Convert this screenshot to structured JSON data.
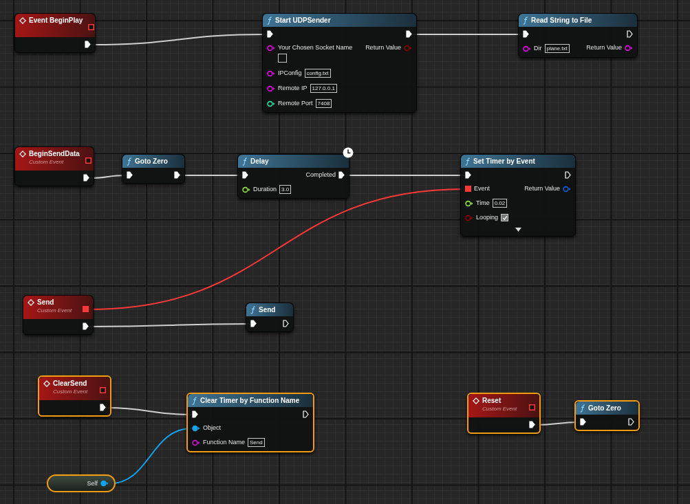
{
  "nodes": [
    {
      "kind": "event",
      "title": "Event BeginPlay",
      "selected": false,
      "delegate": {
        "connected": false
      },
      "rows": [
        {
          "right": {
            "kind": "exec",
            "connected": true
          }
        }
      ]
    },
    {
      "kind": "function",
      "title": "Start UDPSender",
      "selected": false,
      "rows": [
        {
          "left": {
            "kind": "exec",
            "connected": true
          },
          "right": {
            "kind": "exec",
            "connected": true
          }
        },
        {
          "left": {
            "kind": "string",
            "label": "Your Chosen Socket Name",
            "empty_field": true,
            "connected": false
          },
          "right": {
            "kind": "bool",
            "label": "Return Value",
            "connected": false
          }
        },
        {
          "left": {
            "kind": "string",
            "label": "IPConfig",
            "value": "config.txt",
            "connected": false
          }
        },
        {
          "left": {
            "kind": "string",
            "label": "Remote IP",
            "value": "127.0.0.1",
            "connected": false
          }
        },
        {
          "left": {
            "kind": "int",
            "label": "Remote Port",
            "value": "7408",
            "connected": false
          }
        }
      ]
    },
    {
      "kind": "function",
      "title": "Read String to File",
      "selected": false,
      "rows": [
        {
          "left": {
            "kind": "exec",
            "connected": true
          },
          "right": {
            "kind": "exec",
            "connected": false
          }
        },
        {
          "left": {
            "kind": "string",
            "label": "Dir",
            "value": "plane.txt",
            "connected": false
          },
          "right": {
            "kind": "string",
            "label": "Return Value",
            "connected": false
          }
        }
      ]
    },
    {
      "kind": "event",
      "title": "BeginSendData",
      "subtitle": "Custom Event",
      "selected": false,
      "delegate": {
        "connected": false
      },
      "rows": [
        {
          "right": {
            "kind": "exec",
            "connected": true
          }
        }
      ]
    },
    {
      "kind": "function",
      "title": "Goto Zero",
      "selected": false,
      "rows": [
        {
          "left": {
            "kind": "exec",
            "connected": true
          },
          "right": {
            "kind": "exec",
            "connected": true
          }
        }
      ]
    },
    {
      "kind": "function",
      "title": "Delay",
      "selected": false,
      "latent": true,
      "rows": [
        {
          "left": {
            "kind": "exec",
            "connected": true
          },
          "right": {
            "kind": "exec",
            "label": "Completed",
            "connected": true
          }
        },
        {
          "left": {
            "kind": "float",
            "label": "Duration",
            "value": "3.0",
            "connected": false
          }
        }
      ]
    },
    {
      "kind": "function",
      "title": "Set Timer by Event",
      "selected": false,
      "advanced": true,
      "rows": [
        {
          "left": {
            "kind": "exec",
            "connected": true
          },
          "right": {
            "kind": "exec",
            "connected": false
          }
        },
        {
          "left": {
            "kind": "delegate",
            "label": "Event",
            "connected": true
          },
          "right": {
            "kind": "struct",
            "label": "Return Value",
            "connected": false
          }
        },
        {
          "left": {
            "kind": "float",
            "label": "Time",
            "value": "0.02",
            "connected": false
          }
        },
        {
          "left": {
            "kind": "bool",
            "label": "Looping",
            "checked": true,
            "connected": false
          }
        }
      ]
    },
    {
      "kind": "event",
      "title": "Send",
      "subtitle": "Custom Event",
      "selected": false,
      "delegate": {
        "connected": true
      },
      "rows": [
        {
          "right": {
            "kind": "exec",
            "connected": true
          }
        }
      ]
    },
    {
      "kind": "function",
      "title": "Send",
      "selected": false,
      "rows": [
        {
          "left": {
            "kind": "exec",
            "connected": true
          },
          "right": {
            "kind": "exec",
            "connected": false
          }
        }
      ]
    },
    {
      "kind": "event",
      "title": "ClearSend",
      "subtitle": "Custom Event",
      "selected": true,
      "delegate": {
        "connected": false
      },
      "rows": [
        {
          "right": {
            "kind": "exec",
            "connected": true
          }
        }
      ]
    },
    {
      "kind": "function",
      "title": "Clear Timer by Function Name",
      "selected": true,
      "rows": [
        {
          "left": {
            "kind": "exec",
            "connected": true
          },
          "right": {
            "kind": "exec",
            "connected": false
          }
        },
        {
          "left": {
            "kind": "object",
            "label": "Object",
            "connected": true
          }
        },
        {
          "left": {
            "kind": "name",
            "label": "Function Name",
            "value": "Send",
            "connected": false
          }
        }
      ]
    },
    {
      "kind": "event",
      "title": "Reset",
      "subtitle": "Custom Event",
      "selected": true,
      "delegate": {
        "connected": false
      },
      "rows": [
        {
          "right": {
            "kind": "exec",
            "connected": true
          }
        }
      ]
    },
    {
      "kind": "function",
      "title": "Goto Zero",
      "selected": true,
      "rows": [
        {
          "left": {
            "kind": "exec",
            "connected": true
          },
          "right": {
            "kind": "exec",
            "connected": false
          }
        }
      ]
    },
    {
      "kind": "variable",
      "selected": true,
      "rows": [
        {
          "right": {
            "kind": "object",
            "label": "Self",
            "connected": true
          }
        }
      ]
    }
  ]
}
